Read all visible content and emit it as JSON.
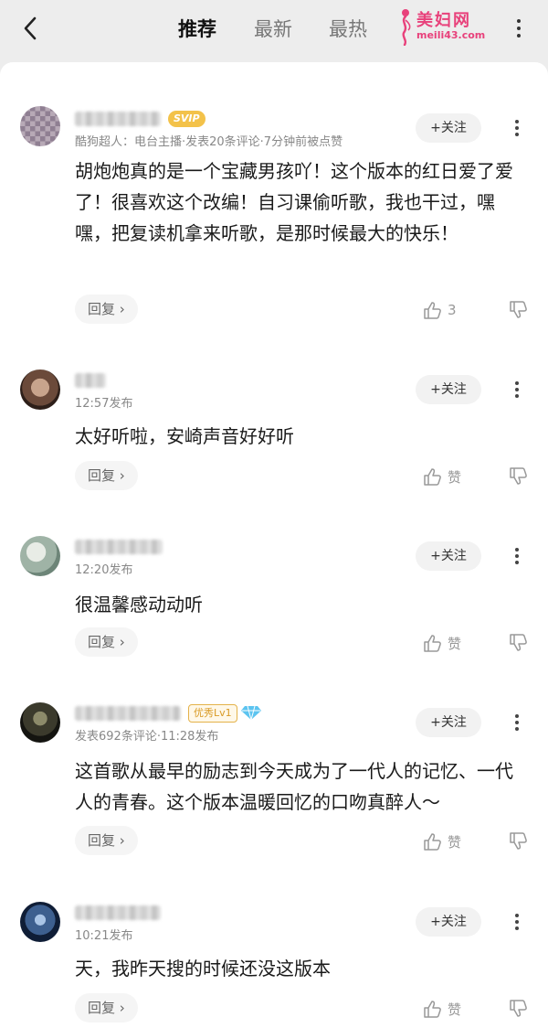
{
  "header": {
    "tabs": [
      {
        "label": "推荐"
      },
      {
        "label": "最新"
      },
      {
        "label": "最热"
      }
    ],
    "watermark": {
      "title": "美妇网",
      "url": "meili43.com"
    }
  },
  "comments": [
    {
      "meta": "酷狗超人：电台主播·发表20条评论·7分钟前被点赞",
      "badge": "SVIP",
      "follow": "+关注",
      "text": "胡炮炮真的是一个宝藏男孩吖！这个版本的红日爱了爱了！很喜欢这个改编！自习课偷听歌，我也干过，嘿嘿，把复读机拿来听歌，是那时候最大的快乐！",
      "reply": "回复",
      "likes": "3"
    },
    {
      "meta": "12:57发布",
      "follow": "+关注",
      "text": "太好听啦，安崎声音好好听",
      "reply": "回复",
      "likes": "赞"
    },
    {
      "meta": "12:20发布",
      "follow": "+关注",
      "text": "很温馨感动动听",
      "reply": "回复",
      "likes": "赞"
    },
    {
      "meta": "发表692条评论·11:28发布",
      "badge": "优秀Lv1",
      "follow": "+关注",
      "text": "这首歌从最早的励志到今天成为了一代人的记忆、一代人的青春。这个版本温暖回忆的口吻真醉人～",
      "reply": "回复",
      "likes": "赞"
    },
    {
      "meta": "10:21发布",
      "follow": "+关注",
      "text": "天，我昨天搜的时候还没这版本",
      "reply": "回复",
      "likes": "赞"
    }
  ],
  "colors": {
    "accent": "#e8417b",
    "svip": "#f3c24a",
    "muted": "#888888"
  }
}
